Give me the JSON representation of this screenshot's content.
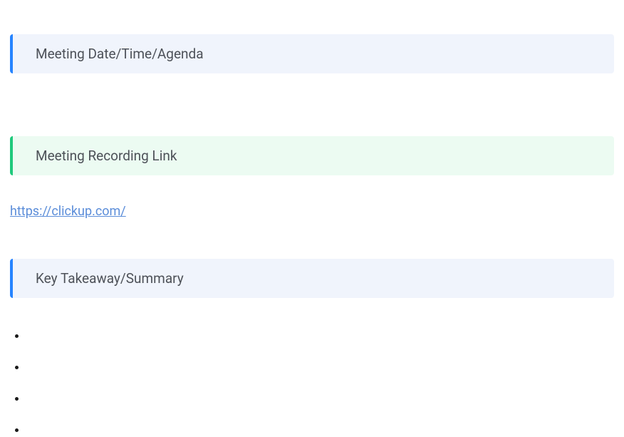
{
  "sections": {
    "meeting_info": {
      "title": "Meeting Date/Time/Agenda",
      "accent": "blue"
    },
    "recording": {
      "title": "Meeting Recording Link",
      "accent": "green",
      "link_text": "https://clickup.com/",
      "link_href": "https://clickup.com/"
    },
    "takeaway": {
      "title": "Key Takeaway/Summary",
      "accent": "blue",
      "bullets": [
        "",
        "",
        "",
        ""
      ]
    }
  }
}
